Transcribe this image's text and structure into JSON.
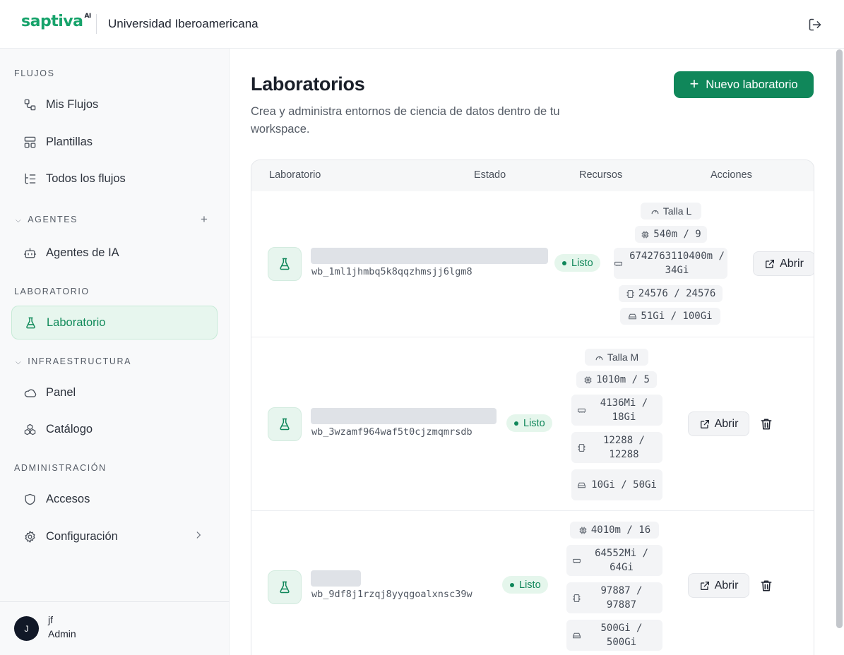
{
  "header": {
    "logo_text": "saptiva",
    "logo_sup": "AI",
    "org_name": "Universidad Iberoamericana",
    "logout_icon": "logout-icon"
  },
  "sidebar": {
    "sections": {
      "flujos": "FLUJOS",
      "agentes": "AGENTES",
      "laboratorio": "LABORATORIO",
      "infraestructura": "INFRAESTRUCTURA",
      "administracion": "ADMINISTRACIÓN"
    },
    "items": {
      "mis_flujos": "Mis Flujos",
      "plantillas": "Plantillas",
      "todos_flujos": "Todos los flujos",
      "agentes_ia": "Agentes de IA",
      "laboratorio": "Laboratorio",
      "panel": "Panel",
      "catalogo": "Catálogo",
      "accesos": "Accesos",
      "configuracion": "Configuración"
    },
    "user": {
      "initial": "J",
      "name": "jf",
      "role": "Admin"
    }
  },
  "main": {
    "title": "Laboratorios",
    "subtitle": "Crea y administra entornos de ciencia de datos dentro de tu workspace.",
    "new_button": "Nuevo laboratorio",
    "columns": {
      "lab": "Laboratorio",
      "estado": "Estado",
      "recursos": "Recursos",
      "acciones": "Acciones"
    },
    "rows": [
      {
        "id": "wb_1ml1jhmbq5k8qqzhmsjj6lgm8",
        "status": "Listo",
        "size": "Talla L",
        "cpu": "540m / 9",
        "memory": "6742763110400m / 34Gi",
        "gpu": "24576 / 24576",
        "storage": "51Gi / 100Gi",
        "open": "Abrir"
      },
      {
        "id": "wb_3wzamf964waf5t0cjzmqmrsdb",
        "status": "Listo",
        "size": "Talla M",
        "cpu": "1010m / 5",
        "memory": "4136Mi / 18Gi",
        "gpu": "12288 / 12288",
        "storage": "10Gi / 50Gi",
        "open": "Abrir"
      },
      {
        "id": "wb_9df8j1rzqj8yyqgoalxnsc39w",
        "status": "Listo",
        "cpu": "4010m / 16",
        "memory": "64552Mi / 64Gi",
        "gpu": "97887 / 97887",
        "storage": "500Gi / 500Gi",
        "open": "Abrir"
      }
    ]
  },
  "colors": {
    "brand": "#17a36b",
    "primary_button": "#10875a",
    "status_ready": "#10875a"
  }
}
